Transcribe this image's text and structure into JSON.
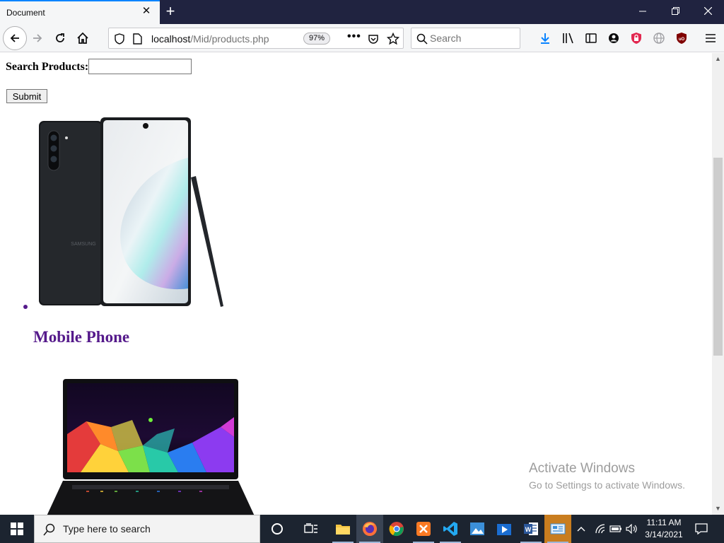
{
  "browser": {
    "tab_title": "Document",
    "url_host": "localhost",
    "url_path": "/Mid/products.php",
    "zoom": "97%",
    "search_placeholder": "Search"
  },
  "page": {
    "search_label": "Search Products:",
    "search_value": "",
    "submit_label": "Submit",
    "products": [
      {
        "name": "Mobile Phone"
      },
      {
        "name": ""
      }
    ]
  },
  "watermark": {
    "title": "Activate Windows",
    "subtitle": "Go to Settings to activate Windows."
  },
  "taskbar": {
    "search_placeholder": "Type here to search",
    "time": "11:11 AM",
    "date": "3/14/2021"
  },
  "colors": {
    "titlebar": "#202340",
    "toolbar": "#f5f6f7",
    "visited_link": "#551a8b",
    "taskbar": "#1c2430"
  }
}
